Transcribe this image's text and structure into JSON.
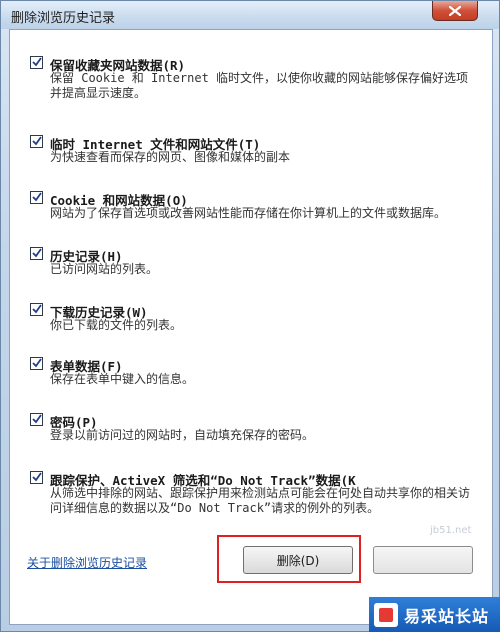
{
  "window": {
    "title": "删除浏览历史记录"
  },
  "items": [
    {
      "title": "保留收藏夹网站数据(R)",
      "desc": "保留 Cookie 和 Internet 临时文件，以使你收藏的网站能够保存偏好选项并提高显示速度。",
      "checked": true
    },
    {
      "title": "临时 Internet 文件和网站文件(T)",
      "desc": "为快速查看而保存的网页、图像和媒体的副本",
      "checked": true
    },
    {
      "title": "Cookie 和网站数据(O)",
      "desc": "网站为了保存首选项或改善网站性能而存储在你计算机上的文件或数据库。",
      "checked": true
    },
    {
      "title": "历史记录(H)",
      "desc": "已访问网站的列表。",
      "checked": true
    },
    {
      "title": "下载历史记录(W)",
      "desc": "你已下载的文件的列表。",
      "checked": true
    },
    {
      "title": "表单数据(F)",
      "desc": "保存在表单中键入的信息。",
      "checked": true
    },
    {
      "title": "密码(P)",
      "desc": "登录以前访问过的网站时，自动填充保存的密码。",
      "checked": true
    },
    {
      "title": "跟踪保护、ActiveX 筛选和“Do Not Track”数据(K",
      "desc": "从筛选中排除的网站、跟踪保护用来检测站点可能会在何处自动共享你的相关访问详细信息的数据以及“Do Not Track”请求的例外的列表。",
      "checked": true
    }
  ],
  "footer": {
    "about_link": "关于删除浏览历史记录",
    "delete_button": "删除(D)"
  },
  "watermark": {
    "text": "易采站长站",
    "faint": "jb51.net"
  },
  "colors": {
    "highlight": "#e02020",
    "link": "#1a4fa0",
    "close": "#c43c23"
  }
}
